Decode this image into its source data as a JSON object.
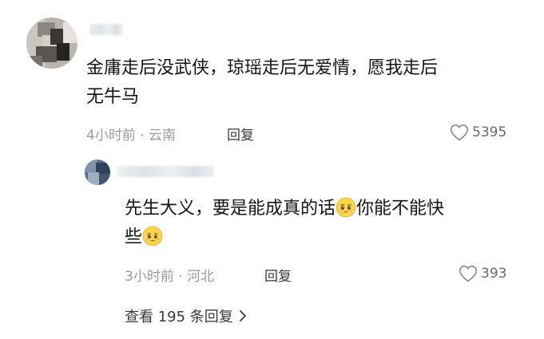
{
  "comment": {
    "text_line1": "金庸走后没武侠，琼瑶走后无爱情，愿我走后",
    "text_line2": "无牛马",
    "time": "4小时前",
    "dot": "·",
    "location": "云南",
    "reply_label": "回复",
    "likes": "5395"
  },
  "reply": {
    "text_line1_a": "先生大义，要是能成真的话",
    "text_line1_b": "你能不能快",
    "text_line2": "些",
    "time": "3小时前",
    "dot": "·",
    "location": "河北",
    "reply_label": "回复",
    "likes": "393"
  },
  "view_replies_label": "查看 195 条回复",
  "icons": {
    "like": "heart-outline-icon",
    "chevron": "chevron-right-icon",
    "emoji": "pleading-face-emoji"
  }
}
